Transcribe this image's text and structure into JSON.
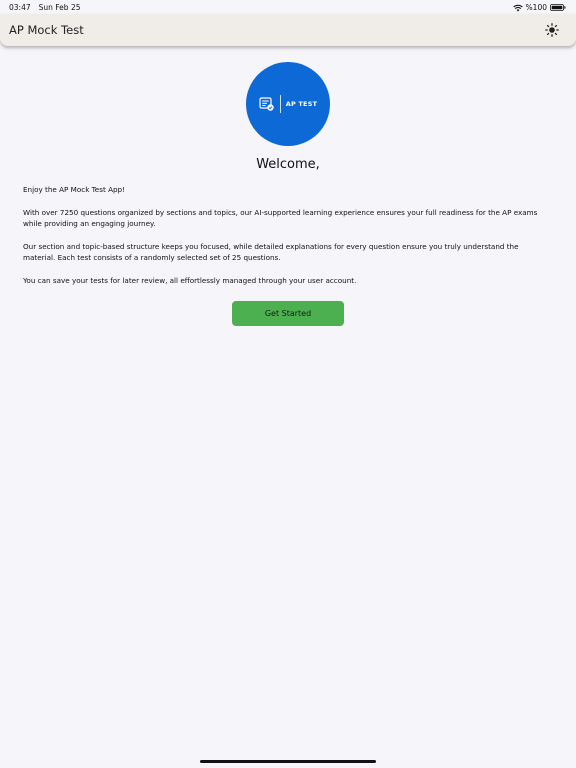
{
  "status_bar": {
    "time": "03:47",
    "date": "Sun Feb 25",
    "battery": "%100"
  },
  "app_bar": {
    "title": "AP Mock Test",
    "theme_icon": "sun-icon"
  },
  "logo": {
    "text": "AP TEST",
    "icon": "test-checklist-icon",
    "color": "#0c69d6"
  },
  "welcome": {
    "heading": "Welcome,",
    "paragraphs": [
      "Enjoy the AP Mock Test App!",
      "With over 7250 questions organized by sections and topics, our AI-supported learning experience ensures your full readiness for the AP exams while providing an engaging journey.",
      "Our section and topic-based structure keeps you focused, while detailed explanations for every question ensure you truly understand the material. Each test consists of a randomly selected set of 25 questions.",
      "You can save your tests for later review, all effortlessly managed through your user account."
    ]
  },
  "actions": {
    "get_started_label": "Get Started",
    "button_color": "#4caf50"
  }
}
